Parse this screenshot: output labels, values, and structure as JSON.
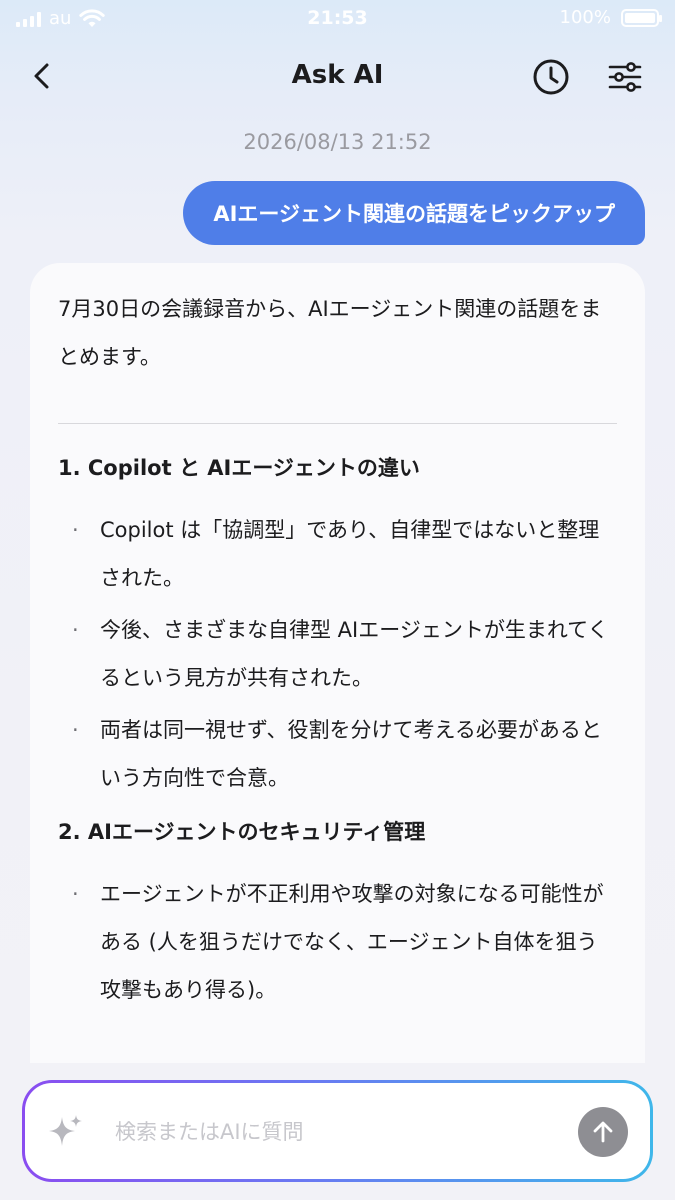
{
  "status_bar": {
    "carrier": "au",
    "time": "21:53",
    "battery_text": "100%",
    "battery_level": 1.0
  },
  "nav": {
    "title": "Ask AI",
    "icons": {
      "back": "chevron-left-icon",
      "history": "clock-icon",
      "settings": "sliders-icon"
    }
  },
  "conversation": {
    "timestamp": "2026/08/13 21:52",
    "user_message": "AIエージェント関連の話題をピックアップ",
    "ai_response": {
      "intro": "7月30日の会議録音から、AIエージェント関連の話題をまとめます。",
      "sections": [
        {
          "heading": "1. Copilot と AIエージェントの違い",
          "bullets": [
            "Copilot は「協調型」であり、自律型ではないと整理された。",
            "今後、さまざまな自律型 AIエージェントが生まれてくるという見方が共有された。",
            "両者は同一視せず、役割を分けて考える必要があるという方向性で合意。"
          ]
        },
        {
          "heading": "2. AIエージェントのセキュリティ管理",
          "bullets": [
            "エージェントが不正利用や攻撃の対象になる可能性がある (人を狙うだけでなく、エージェント自体を狙う攻撃もあり得る)。"
          ]
        }
      ]
    }
  },
  "composer": {
    "placeholder": "検索またはAIに質問",
    "value": "",
    "icons": {
      "left": "sparkle-icon",
      "send": "arrow-up-icon"
    }
  },
  "colors": {
    "user_bubble": "#4f7ee8",
    "send_button": "#8e8e93",
    "gradient_start": "#8a4df0",
    "gradient_end": "#3fb7ea"
  }
}
